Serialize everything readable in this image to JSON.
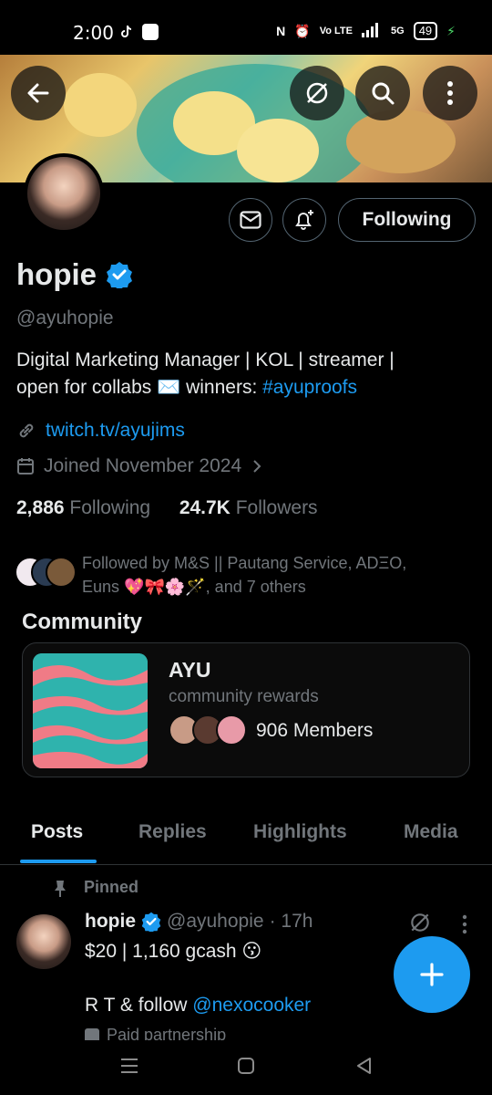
{
  "status_bar": {
    "time": "2:00",
    "network": "5G",
    "battery": "49"
  },
  "profile": {
    "name": "hopie",
    "handle": "@ayuhopie",
    "bio_line1": "Digital Marketing Manager | KOL | streamer |",
    "bio_line2_prefix": "open for collabs ✉️   winners: ",
    "bio_hashtag": "#ayuproofs",
    "website": "twitch.tv/ayujims",
    "joined": "Joined November 2024",
    "following_count": "2,886",
    "following_label": "Following",
    "followers_count": "24.7K",
    "followers_label": "Followers",
    "followed_by_line1": "Followed by M&S || Pautang Service, ADΞO,",
    "followed_by_line2": "Euns 💖🎀🌸🪄, and 7 others"
  },
  "actions": {
    "follow_button": "Following"
  },
  "community": {
    "section_title": "Community",
    "name": "AYU",
    "description": "community rewards",
    "members": "906 Members"
  },
  "tabs": [
    {
      "label": "Posts"
    },
    {
      "label": "Replies"
    },
    {
      "label": "Highlights"
    },
    {
      "label": "Media"
    }
  ],
  "post": {
    "pinned_label": "Pinned",
    "author": "hopie",
    "handle": "@ayuhopie",
    "time": "· 17h",
    "line1": "$20 | 1,160 gcash 😗",
    "line3_prefix": "R T & follow ",
    "mention": "@nexocooker",
    "partial_line": "Paid partnership"
  },
  "colors": {
    "accent": "#1d9bf0",
    "background": "#000000",
    "secondary_text": "#71767b",
    "border": "#2f3336"
  }
}
